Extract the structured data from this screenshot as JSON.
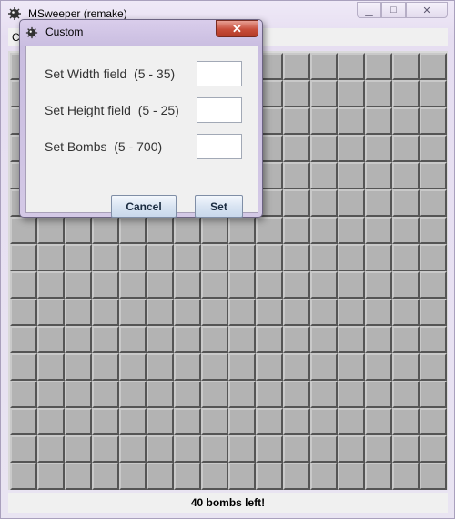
{
  "window": {
    "title": "MSweeper (remake)",
    "controls": {
      "minimize": "▁",
      "maximize": "□",
      "close": "✕"
    }
  },
  "menubar": {
    "visible_item": "C"
  },
  "board": {
    "columns": 16,
    "rows": 16,
    "cell_state": "covered"
  },
  "status": {
    "text": "40 bombs left!"
  },
  "dialog": {
    "title": "Custom",
    "close_glyph": "✕",
    "fields": [
      {
        "label": "Set Width field  (5 - 35)",
        "value": ""
      },
      {
        "label": "Set Height field  (5 - 25)",
        "value": ""
      },
      {
        "label": "Set Bombs  (5 - 700)",
        "value": ""
      }
    ],
    "buttons": {
      "cancel": "Cancel",
      "set": "Set"
    }
  },
  "colors": {
    "cell": "#b3b3b3",
    "close_button": "#c74d3a",
    "title_bar": "#e6def1"
  }
}
